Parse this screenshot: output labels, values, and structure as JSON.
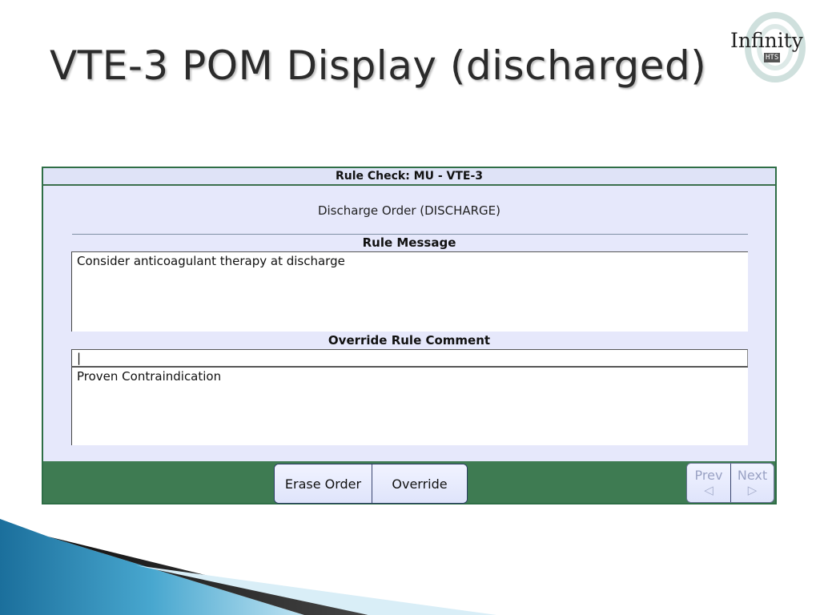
{
  "slide": {
    "title": "VTE-3 POM Display (discharged)"
  },
  "logo": {
    "text": "Infinity",
    "sub": "HTS"
  },
  "dialog": {
    "header": "Rule Check: MU - VTE-3",
    "order_name": "Discharge Order (DISCHARGE)",
    "rule_message_label": "Rule Message",
    "rule_message_text": "Consider anticoagulant therapy at discharge",
    "override_comment_label": "Override Rule Comment",
    "override_comment_input": "|",
    "override_comment_text": "Proven Contraindication"
  },
  "footer": {
    "erase_label": "Erase Order",
    "override_label": "Override",
    "prev_label": "Prev",
    "next_label": "Next"
  },
  "icons": {
    "prev": "left-triangle-icon",
    "next": "right-triangle-icon"
  },
  "colors": {
    "footer_bg": "#3e7b52",
    "dialog_bg": "#e6e8fb",
    "border": "#2e6e46"
  }
}
